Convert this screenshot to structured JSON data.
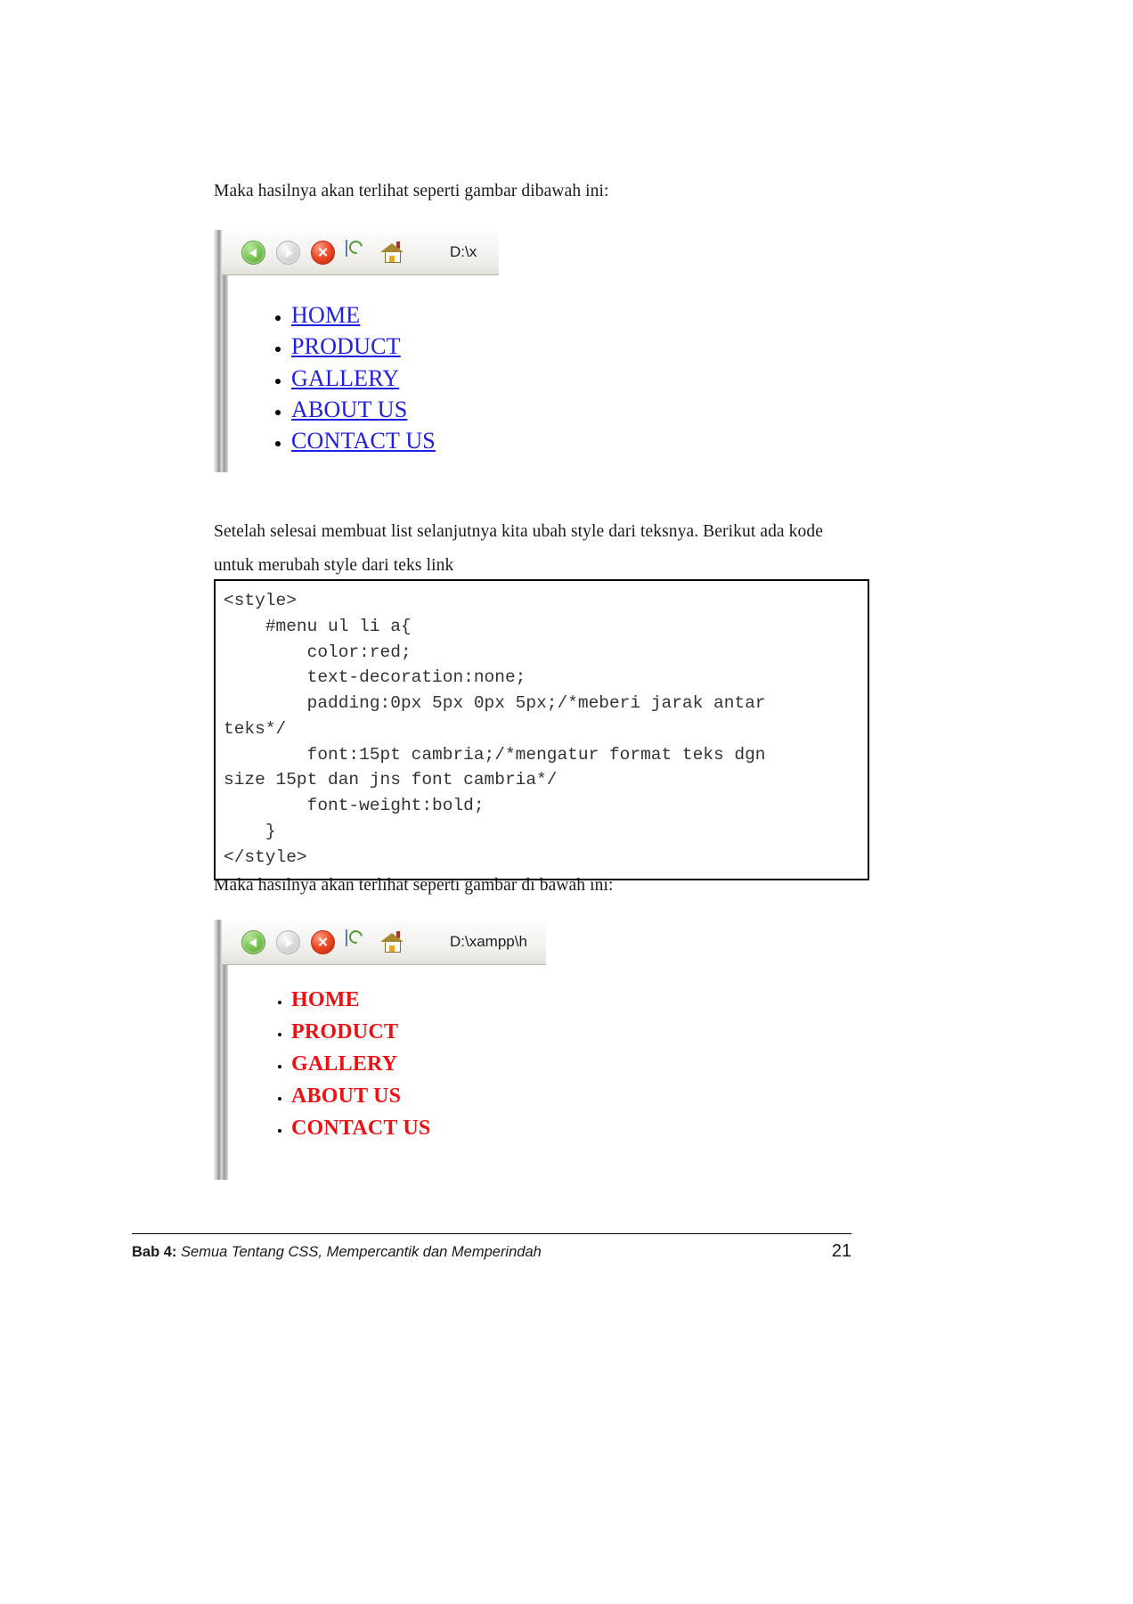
{
  "document": {
    "paragraph_1": "Maka hasilnya akan terlihat seperti gambar dibawah ini:",
    "paragraph_2": "Setelah selesai membuat list selanjutnya kita ubah style dari teksnya. Berikut ada kode untuk merubah style dari teks link",
    "paragraph_3": "Maka hasilnya akan terlihat seperti gambar di bawah ini:"
  },
  "screenshot_1": {
    "address_value": "D:\\x",
    "toolbar_icons": [
      {
        "name": "back-icon",
        "label": "Back"
      },
      {
        "name": "forward-icon",
        "label": "Forward"
      },
      {
        "name": "stop-icon",
        "label": "Stop",
        "glyph": "✕"
      },
      {
        "name": "refresh-icon",
        "label": "Refresh"
      },
      {
        "name": "home-icon",
        "label": "Home"
      }
    ],
    "menu_items": [
      "HOME",
      "PRODUCT",
      "GALLERY",
      "ABOUT US",
      "CONTACT US"
    ],
    "link_color": "#2020e0",
    "link_decoration": "underline"
  },
  "screenshot_2": {
    "address_value": "D:\\xampp\\h",
    "toolbar_icons": [
      {
        "name": "back-icon",
        "label": "Back"
      },
      {
        "name": "forward-icon",
        "label": "Forward"
      },
      {
        "name": "stop-icon",
        "label": "Stop",
        "glyph": "✕"
      },
      {
        "name": "refresh-icon",
        "label": "Refresh"
      },
      {
        "name": "home-icon",
        "label": "Home"
      }
    ],
    "menu_items": [
      "HOME",
      "PRODUCT",
      "GALLERY",
      "ABOUT US",
      "CONTACT US"
    ],
    "link_color": "#ee1111",
    "link_decoration": "none"
  },
  "code_block": {
    "content": "<style>\n    #menu ul li a{\n        color:red;\n        text-decoration:none;\n        padding:0px 5px 0px 5px;/*meberi jarak antar\nteks*/\n        font:15pt cambria;/*mengatur format teks dgn\nsize 15pt dan jns font cambria*/\n        font-weight:bold;\n    }\n</style>"
  },
  "footer": {
    "chapter_label": "Bab 4:",
    "chapter_title": "Semua Tentang CSS, Mempercantik dan Memperindah",
    "page_number": "21"
  }
}
